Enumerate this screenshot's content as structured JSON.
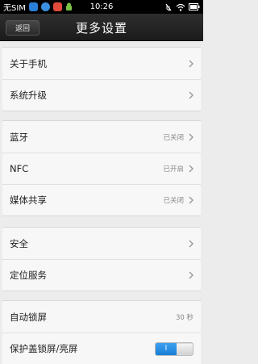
{
  "status_bar": {
    "carrier": "无SIM",
    "time": "10:26",
    "icons": [
      "app-icon",
      "qq-icon",
      "sim-app-icon",
      "android-icon",
      "mute-icon",
      "wifi-icon",
      "battery-icon"
    ]
  },
  "header": {
    "back_label": "返回",
    "title": "更多设置"
  },
  "groups": [
    {
      "items": [
        {
          "label": "关于手机",
          "value": "",
          "icon": "chevron-right-icon"
        },
        {
          "label": "系统升级",
          "value": "",
          "icon": "chevron-right-icon"
        }
      ]
    },
    {
      "items": [
        {
          "label": "蓝牙",
          "value": "已关闭",
          "icon": "chevron-right-icon"
        },
        {
          "label": "NFC",
          "value": "已开启",
          "icon": "chevron-right-icon"
        },
        {
          "label": "媒体共享",
          "value": "已关闭",
          "icon": "chevron-right-icon"
        }
      ]
    },
    {
      "items": [
        {
          "label": "安全",
          "value": "",
          "icon": "chevron-right-icon"
        },
        {
          "label": "定位服务",
          "value": "",
          "icon": "chevron-right-icon"
        }
      ]
    },
    {
      "items": [
        {
          "label": "自动锁屏",
          "value": "30 秒",
          "icon": ""
        },
        {
          "label": "保护盖锁屏/亮屏",
          "value": "",
          "toggle": "I"
        }
      ]
    }
  ]
}
